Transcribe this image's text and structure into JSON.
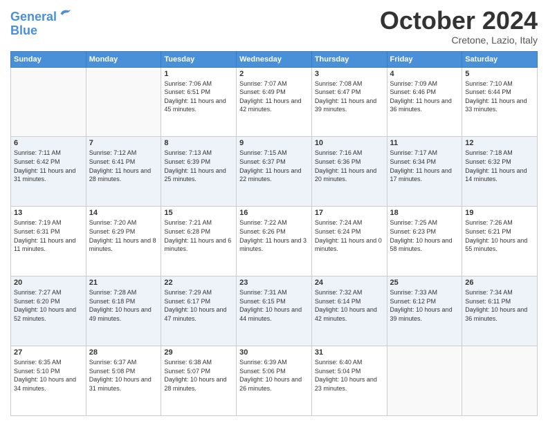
{
  "header": {
    "logo_line1": "General",
    "logo_line2": "Blue",
    "month_title": "October 2024",
    "location": "Cretone, Lazio, Italy"
  },
  "days_of_week": [
    "Sunday",
    "Monday",
    "Tuesday",
    "Wednesday",
    "Thursday",
    "Friday",
    "Saturday"
  ],
  "weeks": [
    [
      {
        "day": "",
        "info": ""
      },
      {
        "day": "",
        "info": ""
      },
      {
        "day": "1",
        "info": "Sunrise: 7:06 AM\nSunset: 6:51 PM\nDaylight: 11 hours and 45 minutes."
      },
      {
        "day": "2",
        "info": "Sunrise: 7:07 AM\nSunset: 6:49 PM\nDaylight: 11 hours and 42 minutes."
      },
      {
        "day": "3",
        "info": "Sunrise: 7:08 AM\nSunset: 6:47 PM\nDaylight: 11 hours and 39 minutes."
      },
      {
        "day": "4",
        "info": "Sunrise: 7:09 AM\nSunset: 6:46 PM\nDaylight: 11 hours and 36 minutes."
      },
      {
        "day": "5",
        "info": "Sunrise: 7:10 AM\nSunset: 6:44 PM\nDaylight: 11 hours and 33 minutes."
      }
    ],
    [
      {
        "day": "6",
        "info": "Sunrise: 7:11 AM\nSunset: 6:42 PM\nDaylight: 11 hours and 31 minutes."
      },
      {
        "day": "7",
        "info": "Sunrise: 7:12 AM\nSunset: 6:41 PM\nDaylight: 11 hours and 28 minutes."
      },
      {
        "day": "8",
        "info": "Sunrise: 7:13 AM\nSunset: 6:39 PM\nDaylight: 11 hours and 25 minutes."
      },
      {
        "day": "9",
        "info": "Sunrise: 7:15 AM\nSunset: 6:37 PM\nDaylight: 11 hours and 22 minutes."
      },
      {
        "day": "10",
        "info": "Sunrise: 7:16 AM\nSunset: 6:36 PM\nDaylight: 11 hours and 20 minutes."
      },
      {
        "day": "11",
        "info": "Sunrise: 7:17 AM\nSunset: 6:34 PM\nDaylight: 11 hours and 17 minutes."
      },
      {
        "day": "12",
        "info": "Sunrise: 7:18 AM\nSunset: 6:32 PM\nDaylight: 11 hours and 14 minutes."
      }
    ],
    [
      {
        "day": "13",
        "info": "Sunrise: 7:19 AM\nSunset: 6:31 PM\nDaylight: 11 hours and 11 minutes."
      },
      {
        "day": "14",
        "info": "Sunrise: 7:20 AM\nSunset: 6:29 PM\nDaylight: 11 hours and 8 minutes."
      },
      {
        "day": "15",
        "info": "Sunrise: 7:21 AM\nSunset: 6:28 PM\nDaylight: 11 hours and 6 minutes."
      },
      {
        "day": "16",
        "info": "Sunrise: 7:22 AM\nSunset: 6:26 PM\nDaylight: 11 hours and 3 minutes."
      },
      {
        "day": "17",
        "info": "Sunrise: 7:24 AM\nSunset: 6:24 PM\nDaylight: 11 hours and 0 minutes."
      },
      {
        "day": "18",
        "info": "Sunrise: 7:25 AM\nSunset: 6:23 PM\nDaylight: 10 hours and 58 minutes."
      },
      {
        "day": "19",
        "info": "Sunrise: 7:26 AM\nSunset: 6:21 PM\nDaylight: 10 hours and 55 minutes."
      }
    ],
    [
      {
        "day": "20",
        "info": "Sunrise: 7:27 AM\nSunset: 6:20 PM\nDaylight: 10 hours and 52 minutes."
      },
      {
        "day": "21",
        "info": "Sunrise: 7:28 AM\nSunset: 6:18 PM\nDaylight: 10 hours and 49 minutes."
      },
      {
        "day": "22",
        "info": "Sunrise: 7:29 AM\nSunset: 6:17 PM\nDaylight: 10 hours and 47 minutes."
      },
      {
        "day": "23",
        "info": "Sunrise: 7:31 AM\nSunset: 6:15 PM\nDaylight: 10 hours and 44 minutes."
      },
      {
        "day": "24",
        "info": "Sunrise: 7:32 AM\nSunset: 6:14 PM\nDaylight: 10 hours and 42 minutes."
      },
      {
        "day": "25",
        "info": "Sunrise: 7:33 AM\nSunset: 6:12 PM\nDaylight: 10 hours and 39 minutes."
      },
      {
        "day": "26",
        "info": "Sunrise: 7:34 AM\nSunset: 6:11 PM\nDaylight: 10 hours and 36 minutes."
      }
    ],
    [
      {
        "day": "27",
        "info": "Sunrise: 6:35 AM\nSunset: 5:10 PM\nDaylight: 10 hours and 34 minutes."
      },
      {
        "day": "28",
        "info": "Sunrise: 6:37 AM\nSunset: 5:08 PM\nDaylight: 10 hours and 31 minutes."
      },
      {
        "day": "29",
        "info": "Sunrise: 6:38 AM\nSunset: 5:07 PM\nDaylight: 10 hours and 28 minutes."
      },
      {
        "day": "30",
        "info": "Sunrise: 6:39 AM\nSunset: 5:06 PM\nDaylight: 10 hours and 26 minutes."
      },
      {
        "day": "31",
        "info": "Sunrise: 6:40 AM\nSunset: 5:04 PM\nDaylight: 10 hours and 23 minutes."
      },
      {
        "day": "",
        "info": ""
      },
      {
        "day": "",
        "info": ""
      }
    ]
  ]
}
